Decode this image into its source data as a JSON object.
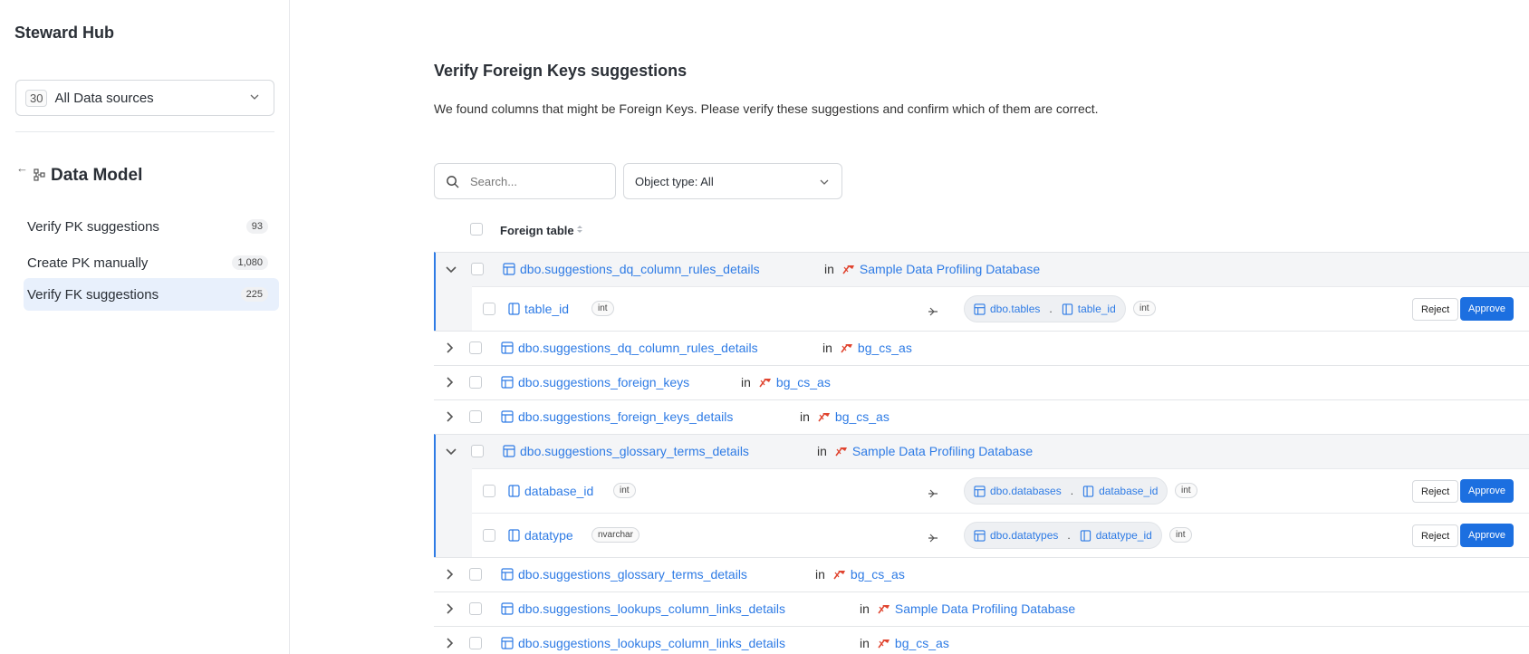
{
  "sidebar": {
    "brand": "Steward Hub",
    "datasource": {
      "count": "30",
      "label": "All Data sources"
    },
    "back_icon": "←",
    "section_title": "Data Model",
    "items": [
      {
        "label": "Verify PK suggestions",
        "badge": "93"
      },
      {
        "label": "Create PK manually",
        "badge": "1,080"
      },
      {
        "label": "Verify FK suggestions",
        "badge": "225"
      }
    ]
  },
  "main": {
    "title": "Verify Foreign Keys suggestions",
    "description": "We found columns that might be Foreign Keys. Please verify these suggestions and confirm which of them are correct.",
    "search_placeholder": "Search...",
    "object_type": "Object type: All",
    "column_header": "Foreign table",
    "in_word": "in",
    "reject_label": "Reject",
    "approve_label": "Approve",
    "groups": [
      {
        "table": "dbo.suggestions_dq_column_rules_details",
        "database": "Sample Data Profiling Database",
        "expanded": true,
        "subs": [
          {
            "column": "table_id",
            "type": "int",
            "ref_table": "dbo.tables",
            "ref_column": "table_id",
            "ref_type": "int"
          }
        ]
      },
      {
        "table": "dbo.suggestions_dq_column_rules_details",
        "database": "bg_cs_as",
        "expanded": false
      },
      {
        "table": "dbo.suggestions_foreign_keys",
        "database": "bg_cs_as",
        "expanded": false
      },
      {
        "table": "dbo.suggestions_foreign_keys_details",
        "database": "bg_cs_as",
        "expanded": false
      },
      {
        "table": "dbo.suggestions_glossary_terms_details",
        "database": "Sample Data Profiling Database",
        "expanded": true,
        "subs": [
          {
            "column": "database_id",
            "type": "int",
            "ref_table": "dbo.databases",
            "ref_column": "database_id",
            "ref_type": "int"
          },
          {
            "column": "datatype",
            "type": "nvarchar",
            "ref_table": "dbo.datatypes",
            "ref_column": "datatype_id",
            "ref_type": "int"
          }
        ]
      },
      {
        "table": "dbo.suggestions_glossary_terms_details",
        "database": "bg_cs_as",
        "expanded": false
      },
      {
        "table": "dbo.suggestions_lookups_column_links_details",
        "database": "Sample Data Profiling Database",
        "expanded": false
      },
      {
        "table": "dbo.suggestions_lookups_column_links_details",
        "database": "bg_cs_as",
        "expanded": false
      }
    ]
  },
  "colors": {
    "accent": "#2e7be5",
    "approve": "#1c6fe0",
    "active_nav": "#e8f0fc",
    "db_icon": "#e0442f"
  }
}
